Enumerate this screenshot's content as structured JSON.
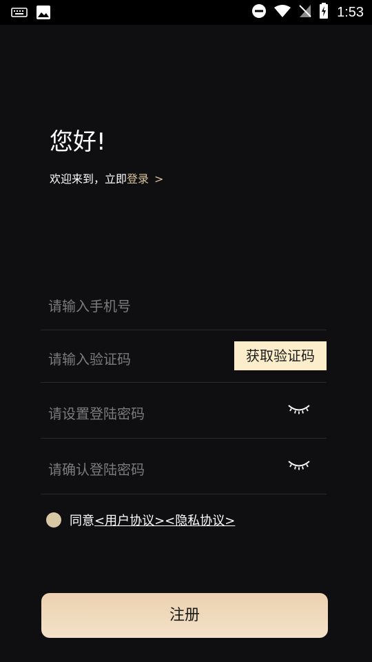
{
  "status_bar": {
    "time": "1:53",
    "icons": [
      "keyboard-icon",
      "image-icon",
      "do-not-disturb-icon",
      "wifi-icon",
      "no-sim-icon",
      "battery-charging-icon"
    ]
  },
  "header": {
    "greeting": "您好!",
    "welcome_prefix": "欢迎来到，立即",
    "login_link": "登录",
    "login_chevron": ">"
  },
  "form": {
    "phone_placeholder": "请输入手机号",
    "code_placeholder": "请输入验证码",
    "get_code_label": "获取验证码",
    "password_placeholder": "请设置登陆密码",
    "confirm_password_placeholder": "请确认登陆密码"
  },
  "agreement": {
    "prefix": "同意",
    "user_agreement": "<用户协议>",
    "privacy_policy": "<隐私协议>"
  },
  "register_label": "注册",
  "colors": {
    "background": "#0f0e10",
    "accent": "#d8c39a",
    "button": "#f0dcc0",
    "code_button": "#fdeecb",
    "placeholder": "#7b7a7d"
  }
}
